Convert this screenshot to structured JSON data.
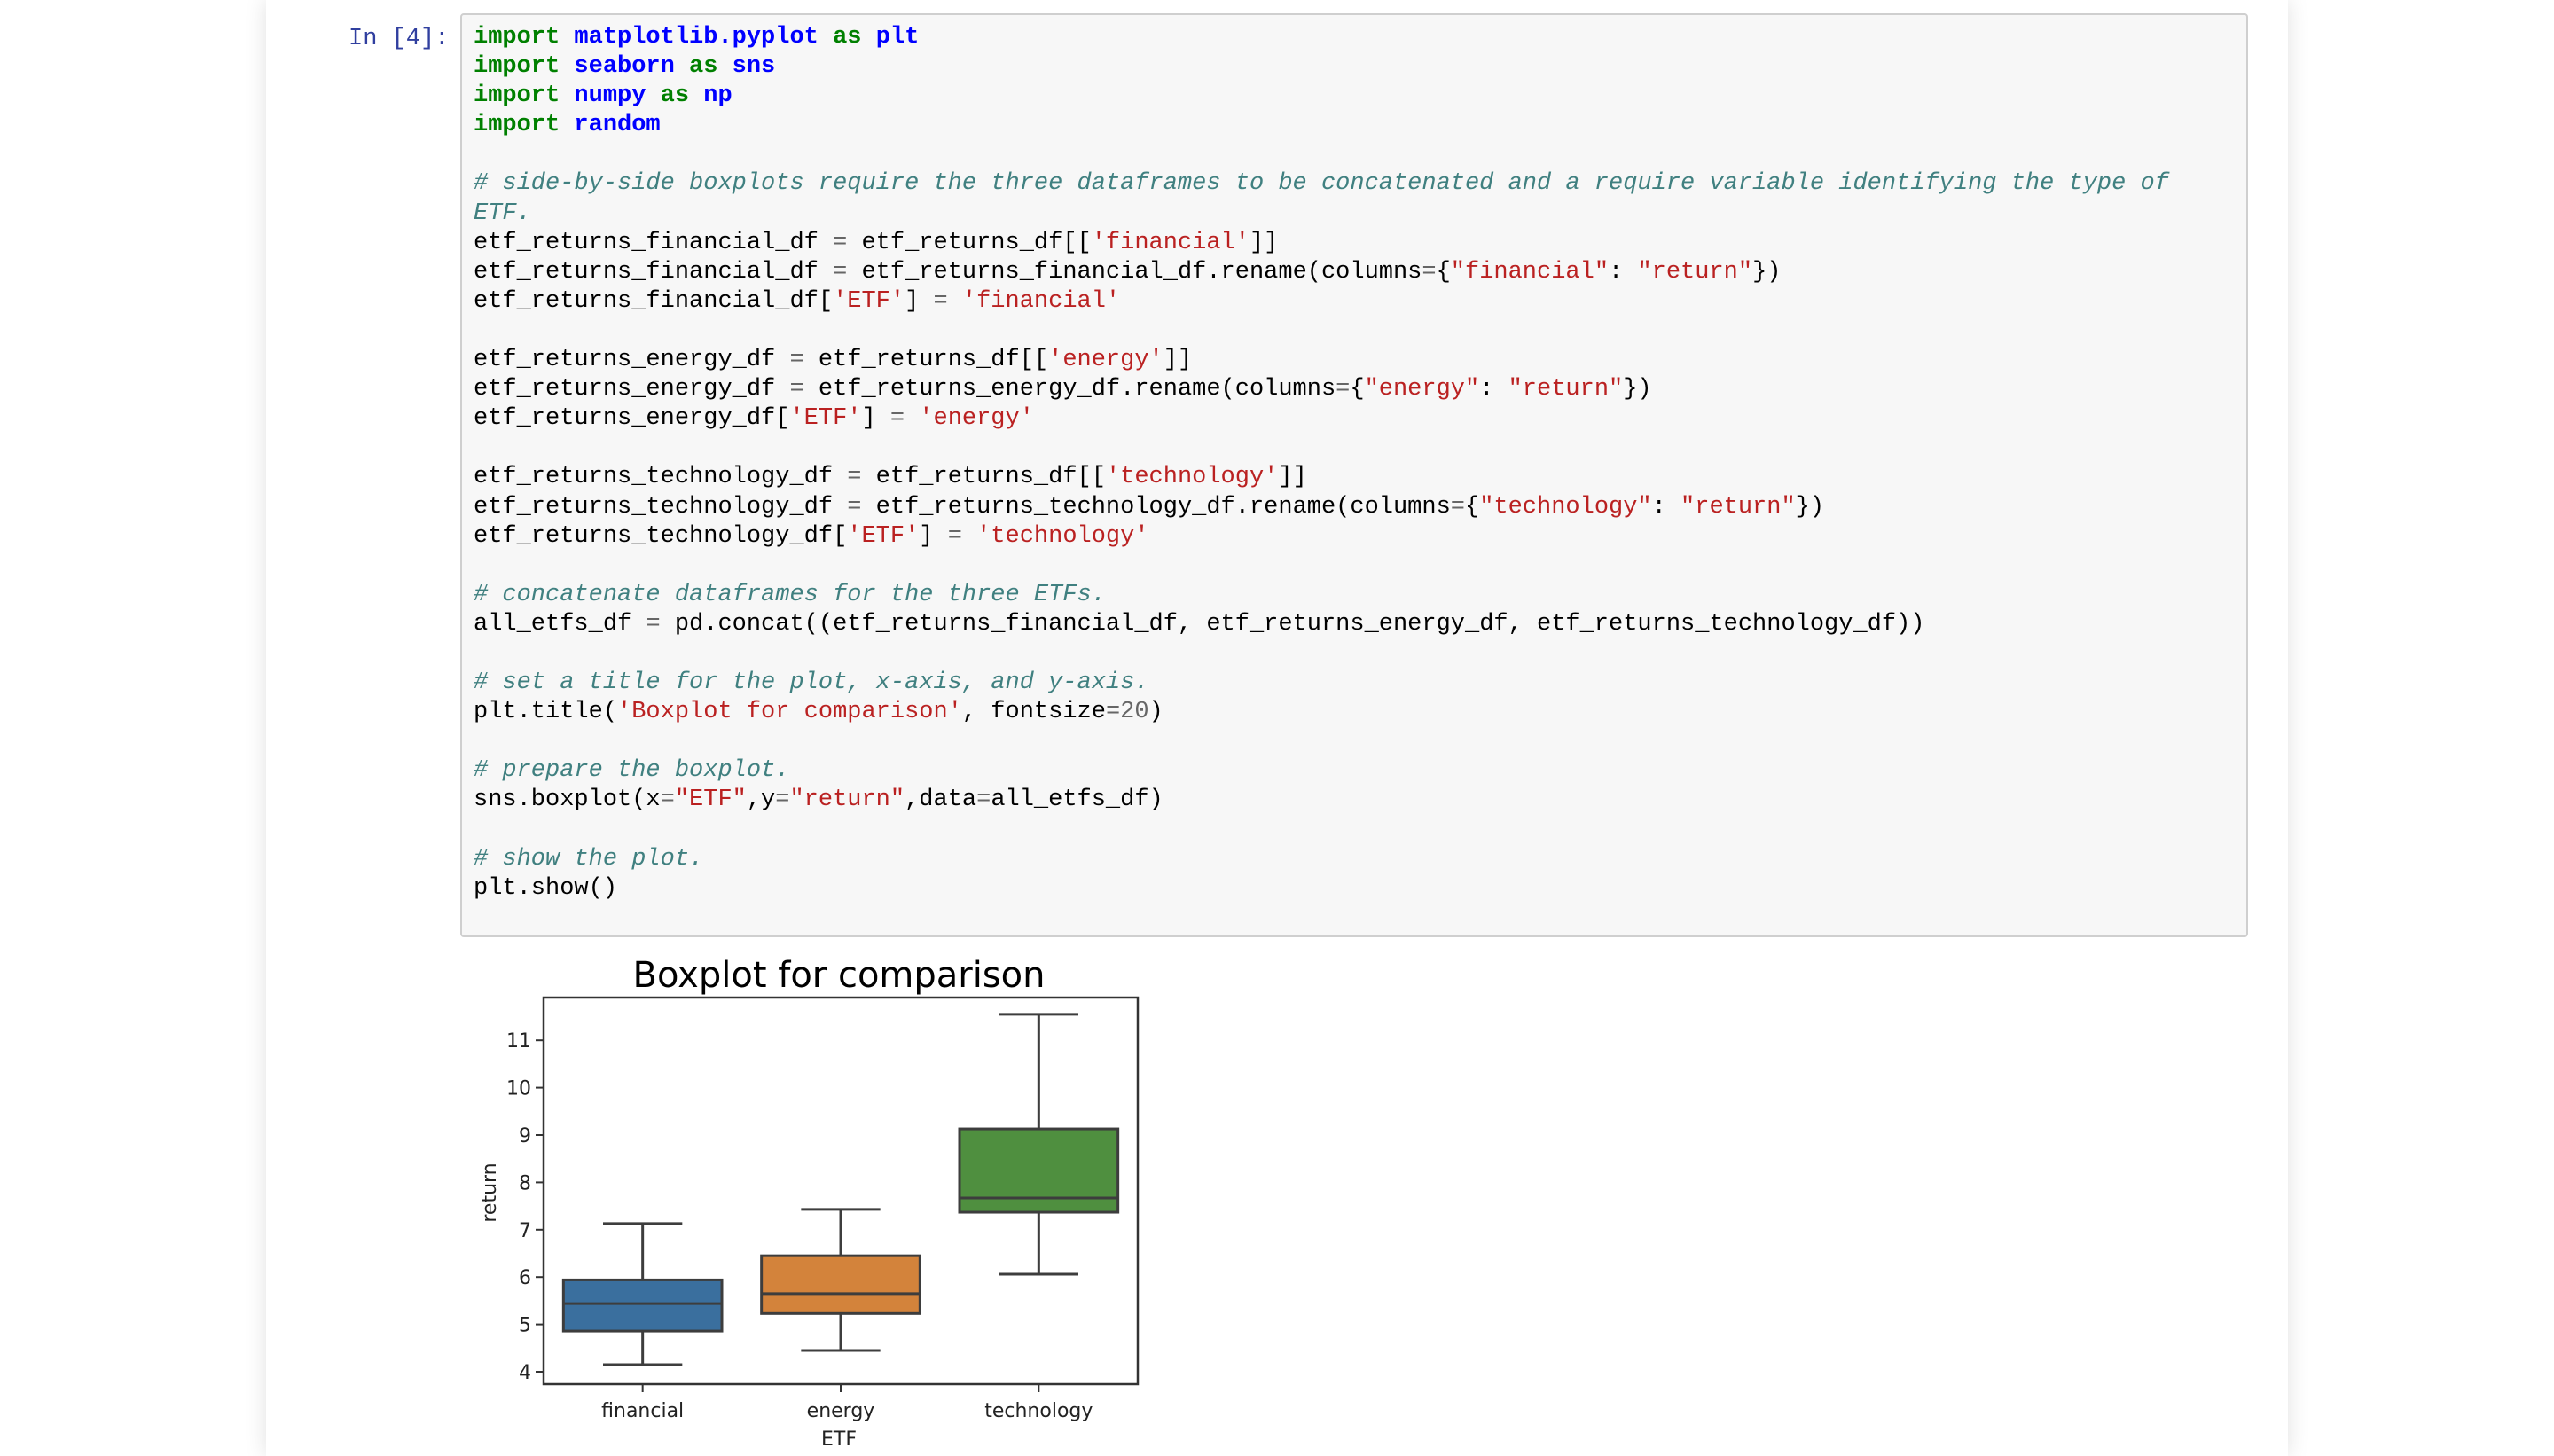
{
  "cell": {
    "prompt": "In [4]:",
    "code_lines": [
      [
        [
          "kw",
          "import"
        ],
        [
          "n",
          " "
        ],
        [
          "nn",
          "matplotlib.pyplot"
        ],
        [
          "n",
          " "
        ],
        [
          "kw",
          "as"
        ],
        [
          "n",
          " "
        ],
        [
          "nn",
          "plt"
        ]
      ],
      [
        [
          "kw",
          "import"
        ],
        [
          "n",
          " "
        ],
        [
          "nn",
          "seaborn"
        ],
        [
          "n",
          " "
        ],
        [
          "kw",
          "as"
        ],
        [
          "n",
          " "
        ],
        [
          "nn",
          "sns"
        ]
      ],
      [
        [
          "kw",
          "import"
        ],
        [
          "n",
          " "
        ],
        [
          "nn",
          "numpy"
        ],
        [
          "n",
          " "
        ],
        [
          "kw",
          "as"
        ],
        [
          "n",
          " "
        ],
        [
          "nn",
          "np"
        ]
      ],
      [
        [
          "kw",
          "import"
        ],
        [
          "n",
          " "
        ],
        [
          "nn",
          "random"
        ]
      ],
      [],
      [
        [
          "c",
          "# side-by-side boxplots require the three dataframes to be concatenated and a require variable identifying the type of"
        ]
      ],
      [
        [
          "c",
          "ETF."
        ]
      ],
      [
        [
          "n",
          "etf_returns_financial_df "
        ],
        [
          "o",
          "="
        ],
        [
          "n",
          " etf_returns_df[["
        ],
        [
          "s",
          "'financial'"
        ],
        [
          "n",
          "]]"
        ]
      ],
      [
        [
          "n",
          "etf_returns_financial_df "
        ],
        [
          "o",
          "="
        ],
        [
          "n",
          " etf_returns_financial_df.rename(columns"
        ],
        [
          "o",
          "="
        ],
        [
          "n",
          "{"
        ],
        [
          "s",
          "\"financial\""
        ],
        [
          "n",
          ": "
        ],
        [
          "s",
          "\"return\""
        ],
        [
          "n",
          "})"
        ]
      ],
      [
        [
          "n",
          "etf_returns_financial_df["
        ],
        [
          "s",
          "'ETF'"
        ],
        [
          "n",
          "] "
        ],
        [
          "o",
          "="
        ],
        [
          "n",
          " "
        ],
        [
          "s",
          "'financial'"
        ]
      ],
      [],
      [
        [
          "n",
          "etf_returns_energy_df "
        ],
        [
          "o",
          "="
        ],
        [
          "n",
          " etf_returns_df[["
        ],
        [
          "s",
          "'energy'"
        ],
        [
          "n",
          "]]"
        ]
      ],
      [
        [
          "n",
          "etf_returns_energy_df "
        ],
        [
          "o",
          "="
        ],
        [
          "n",
          " etf_returns_energy_df.rename(columns"
        ],
        [
          "o",
          "="
        ],
        [
          "n",
          "{"
        ],
        [
          "s",
          "\"energy\""
        ],
        [
          "n",
          ": "
        ],
        [
          "s",
          "\"return\""
        ],
        [
          "n",
          "})"
        ]
      ],
      [
        [
          "n",
          "etf_returns_energy_df["
        ],
        [
          "s",
          "'ETF'"
        ],
        [
          "n",
          "] "
        ],
        [
          "o",
          "="
        ],
        [
          "n",
          " "
        ],
        [
          "s",
          "'energy'"
        ]
      ],
      [],
      [
        [
          "n",
          "etf_returns_technology_df "
        ],
        [
          "o",
          "="
        ],
        [
          "n",
          " etf_returns_df[["
        ],
        [
          "s",
          "'technology'"
        ],
        [
          "n",
          "]]"
        ]
      ],
      [
        [
          "n",
          "etf_returns_technology_df "
        ],
        [
          "o",
          "="
        ],
        [
          "n",
          " etf_returns_technology_df.rename(columns"
        ],
        [
          "o",
          "="
        ],
        [
          "n",
          "{"
        ],
        [
          "s",
          "\"technology\""
        ],
        [
          "n",
          ": "
        ],
        [
          "s",
          "\"return\""
        ],
        [
          "n",
          "})"
        ]
      ],
      [
        [
          "n",
          "etf_returns_technology_df["
        ],
        [
          "s",
          "'ETF'"
        ],
        [
          "n",
          "] "
        ],
        [
          "o",
          "="
        ],
        [
          "n",
          " "
        ],
        [
          "s",
          "'technology'"
        ]
      ],
      [],
      [
        [
          "c",
          "# concatenate dataframes for the three ETFs."
        ]
      ],
      [
        [
          "n",
          "all_etfs_df "
        ],
        [
          "o",
          "="
        ],
        [
          "n",
          " pd.concat((etf_returns_financial_df, etf_returns_energy_df, etf_returns_technology_df))"
        ]
      ],
      [],
      [
        [
          "c",
          "# set a title for the plot, x-axis, and y-axis."
        ]
      ],
      [
        [
          "n",
          "plt.title("
        ],
        [
          "s",
          "'Boxplot for comparison'"
        ],
        [
          "n",
          ", fontsize"
        ],
        [
          "o",
          "="
        ],
        [
          "m",
          "20"
        ],
        [
          "n",
          ")"
        ]
      ],
      [],
      [
        [
          "c",
          "# prepare the boxplot."
        ]
      ],
      [
        [
          "n",
          "sns.boxplot(x"
        ],
        [
          "o",
          "="
        ],
        [
          "s",
          "\"ETF\""
        ],
        [
          "n",
          ",y"
        ],
        [
          "o",
          "="
        ],
        [
          "s",
          "\"return\""
        ],
        [
          "n",
          ",data"
        ],
        [
          "o",
          "="
        ],
        [
          "n",
          "all_etfs_df)"
        ]
      ],
      [],
      [
        [
          "c",
          "# show the plot."
        ]
      ],
      [
        [
          "n",
          "plt.show()"
        ]
      ]
    ]
  },
  "chart_data": {
    "type": "box",
    "title": "Boxplot for comparison",
    "xlabel": "ETF",
    "ylabel": "return",
    "categories": [
      "financial",
      "energy",
      "technology"
    ],
    "series": [
      {
        "name": "financial",
        "whisker_low": 4.15,
        "q1": 4.86,
        "median": 5.44,
        "q3": 5.94,
        "whisker_high": 7.13,
        "color": "#3a6f9e"
      },
      {
        "name": "energy",
        "whisker_low": 4.45,
        "q1": 5.23,
        "median": 5.65,
        "q3": 6.45,
        "whisker_high": 7.43,
        "color": "#d3833b"
      },
      {
        "name": "technology",
        "whisker_low": 6.06,
        "q1": 7.37,
        "median": 7.67,
        "q3": 9.13,
        "whisker_high": 11.55,
        "color": "#4f8f3f"
      }
    ],
    "yticks": [
      4,
      5,
      6,
      7,
      8,
      9,
      10,
      11
    ],
    "ylim": [
      3.74,
      11.91
    ],
    "grid": false,
    "legend": "none"
  }
}
